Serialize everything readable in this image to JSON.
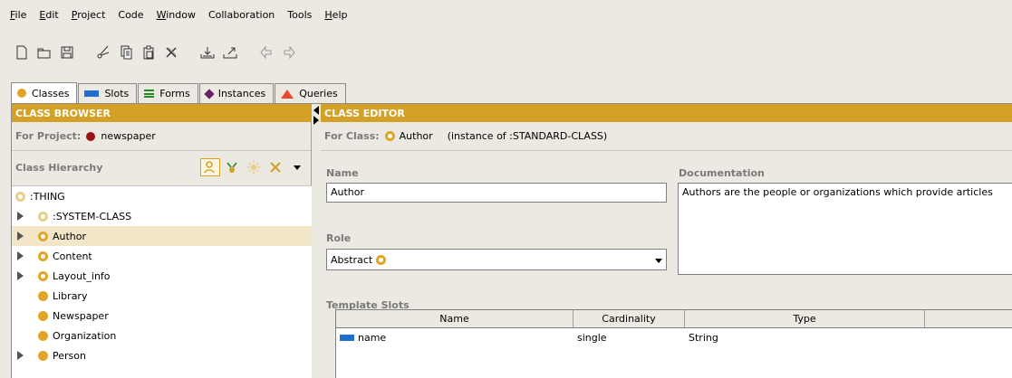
{
  "menu": [
    "File",
    "Edit",
    "Project",
    "Code",
    "Window",
    "Collaboration",
    "Tools",
    "Help"
  ],
  "toolbar_icons": [
    "new-file-icon",
    "open-folder-icon",
    "save-icon",
    "cut-icon",
    "copy-icon",
    "paste-icon",
    "delete-icon",
    "import-icon",
    "export-icon",
    "undo-icon",
    "redo-icon"
  ],
  "tabs": [
    {
      "label": "Classes",
      "icon": "class-dot-icon",
      "color": "#e0a526"
    },
    {
      "label": "Slots",
      "icon": "slot-bar-icon",
      "color": "#1e6fcf"
    },
    {
      "label": "Forms",
      "icon": "forms-icon",
      "color": "#1f8d1f"
    },
    {
      "label": "Instances",
      "icon": "instance-diamond-icon",
      "color": "#6a1f6a"
    },
    {
      "label": "Queries",
      "icon": "query-triangle-icon",
      "color": "#e8482c"
    }
  ],
  "class_browser": {
    "title": "CLASS BROWSER",
    "project_label": "For Project:",
    "project_name": "newspaper",
    "hierarchy_label": "Class Hierarchy",
    "tree": [
      {
        "label": ":THING",
        "expandable": false,
        "selected": false
      },
      {
        "label": ":SYSTEM-CLASS",
        "expandable": true,
        "selected": false
      },
      {
        "label": "Author",
        "expandable": true,
        "selected": true
      },
      {
        "label": "Content",
        "expandable": true,
        "selected": false
      },
      {
        "label": "Layout_info",
        "expandable": true,
        "selected": false
      },
      {
        "label": "Library",
        "expandable": false,
        "selected": false
      },
      {
        "label": "Newspaper",
        "expandable": false,
        "selected": false
      },
      {
        "label": "Organization",
        "expandable": false,
        "selected": false
      },
      {
        "label": "Person",
        "expandable": true,
        "selected": false
      }
    ]
  },
  "class_editor": {
    "title": "CLASS EDITOR",
    "for_class_label": "For Class:",
    "class_name": "Author",
    "instance_of": "(instance of :STANDARD-CLASS)",
    "name_label": "Name",
    "name_value": "Author",
    "documentation_label": "Documentation",
    "documentation_value": "Authors are the people or organizations which provide articles",
    "role_label": "Role",
    "role_value": "Abstract",
    "template_slots_label": "Template Slots",
    "slot_columns": [
      "Name",
      "Cardinality",
      "Type"
    ],
    "slots": [
      {
        "name": "name",
        "cardinality": "single",
        "type": "String"
      }
    ]
  },
  "colors": {
    "header_bg": "#d4a127",
    "class_icon": "#e0a526",
    "selection": "#f1e6c7",
    "project_icon": "#9b1414"
  }
}
